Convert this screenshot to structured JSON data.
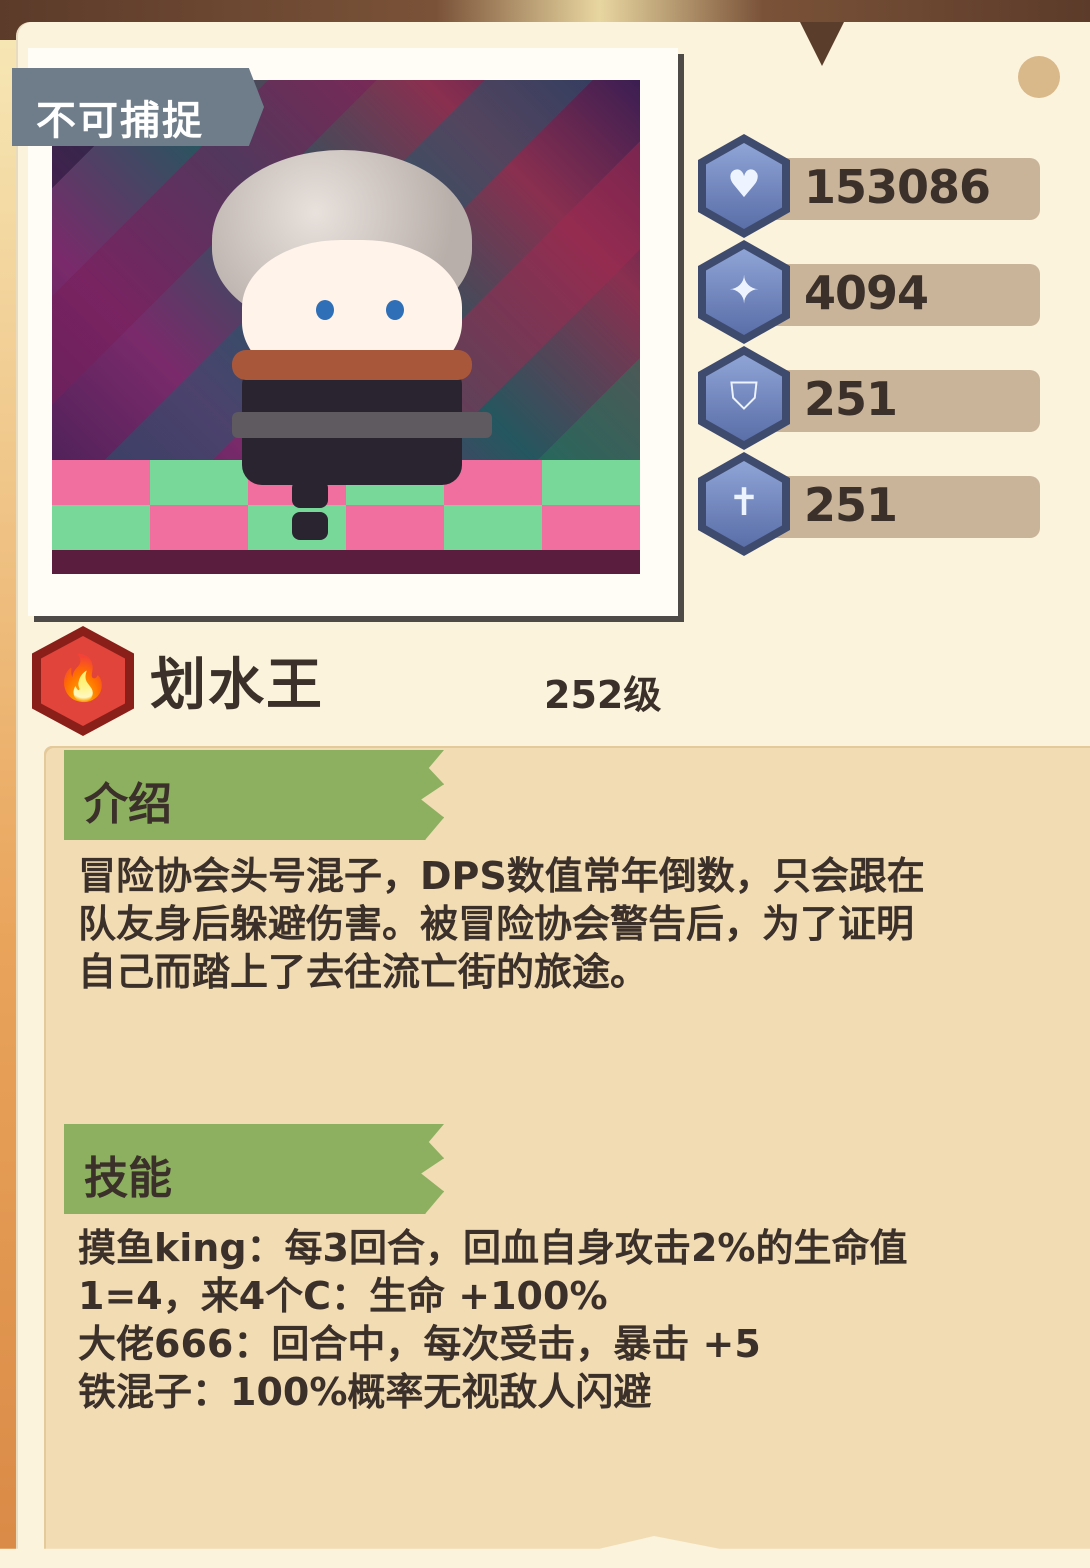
{
  "hero": {
    "status_tag": "不可捕捉",
    "name": "划水王",
    "level": "252级",
    "element_icon": "fire-icon"
  },
  "stats": [
    {
      "icon": "heart-icon",
      "value": "153086"
    },
    {
      "icon": "sword-icon",
      "value": "4094"
    },
    {
      "icon": "shield-icon",
      "value": "251"
    },
    {
      "icon": "ice-sword-icon",
      "value": "251"
    }
  ],
  "intro": {
    "title": "介绍",
    "lines": [
      "冒险协会头号混子，DPS数值常年倒数，只会跟在",
      "队友身后躲避伤害。被冒险协会警告后，为了证明",
      "自己而踏上了去往流亡街的旅途。"
    ]
  },
  "skills": {
    "title": "技能",
    "lines": [
      "摸鱼king：每3回合，回血自身攻击2%的生命值",
      "1=4，来4个C：生命 +100%",
      "大佬666：回合中，每次受击，暴击 +5",
      "铁混子：100%概率无视敌人闪避"
    ]
  },
  "colors": {
    "card": "#fbf3dc",
    "panel": "#f2dcb4",
    "tag_green": "#8db060",
    "stat_bar": "#c9b49a",
    "text": "#3b302a"
  }
}
